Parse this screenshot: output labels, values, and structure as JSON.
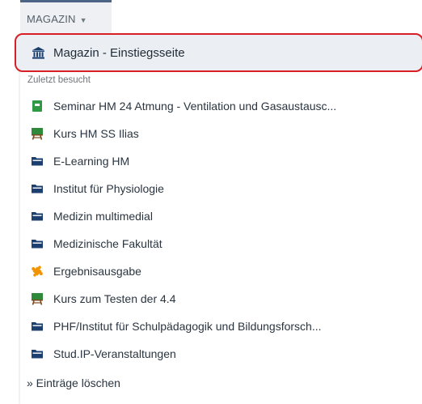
{
  "menu": {
    "tab_label": "MAGAZIN",
    "start_page_label": "Magazin - Einstiegsseite",
    "recent_section_label": "Zuletzt besucht",
    "recent_items": [
      {
        "label": "Seminar HM 24 Atmung - Ventilation und Gasaustausc...",
        "icon": "page-icon"
      },
      {
        "label": "Kurs HM SS Ilias",
        "icon": "course-icon"
      },
      {
        "label": "E-Learning HM",
        "icon": "folder-icon"
      },
      {
        "label": "Institut für Physiologie",
        "icon": "folder-icon"
      },
      {
        "label": "Medizin multimedial",
        "icon": "folder-icon"
      },
      {
        "label": "Medizinische Fakultät",
        "icon": "folder-icon"
      },
      {
        "label": "Ergebnisausgabe",
        "icon": "puzzle-icon"
      },
      {
        "label": "Kurs zum Testen der 4.4",
        "icon": "course-icon"
      },
      {
        "label": "PHF/Institut für Schulpädagogik und Bildungsforsch...",
        "icon": "folder-icon"
      },
      {
        "label": "Stud.IP-Veranstaltungen",
        "icon": "folder-icon"
      }
    ],
    "clear_label": "» Einträge löschen"
  },
  "colors": {
    "tab_accent": "#4c6586",
    "highlight_border": "#d81f26",
    "folder": "#1d3f70",
    "page": "#2e9a46",
    "course": "#2e8a3a",
    "puzzle": "#f29400"
  }
}
